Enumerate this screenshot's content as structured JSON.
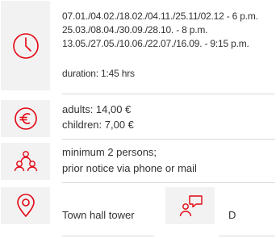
{
  "theme": {
    "accent": "#e30613",
    "tile_bg": "#f2f2f2",
    "text": "#333333",
    "rule": "#d9d9d9"
  },
  "schedule": {
    "icon": "clock-icon",
    "lines": [
      "07.01./04.02./18.02./04.11./25.11/02.12 - 6 p.m.",
      "25.03./08.04./30.09./28.10. - 8 p.m.",
      "13.05./27.05./10.06./22.07./16.09. - 9:15 p.m."
    ],
    "duration": "duration: 1:45 hrs"
  },
  "price": {
    "icon": "euro-icon",
    "adults": "adults: 14,00 €",
    "children": "children: 7,00 €"
  },
  "group": {
    "icon": "people-icon",
    "line1": "minimum 2 persons;",
    "line2": "prior notice via phone or mail"
  },
  "location": {
    "icon": "location-pin-icon",
    "label": "Town hall tower"
  },
  "language": {
    "icon": "speech-icon",
    "label": "D"
  }
}
